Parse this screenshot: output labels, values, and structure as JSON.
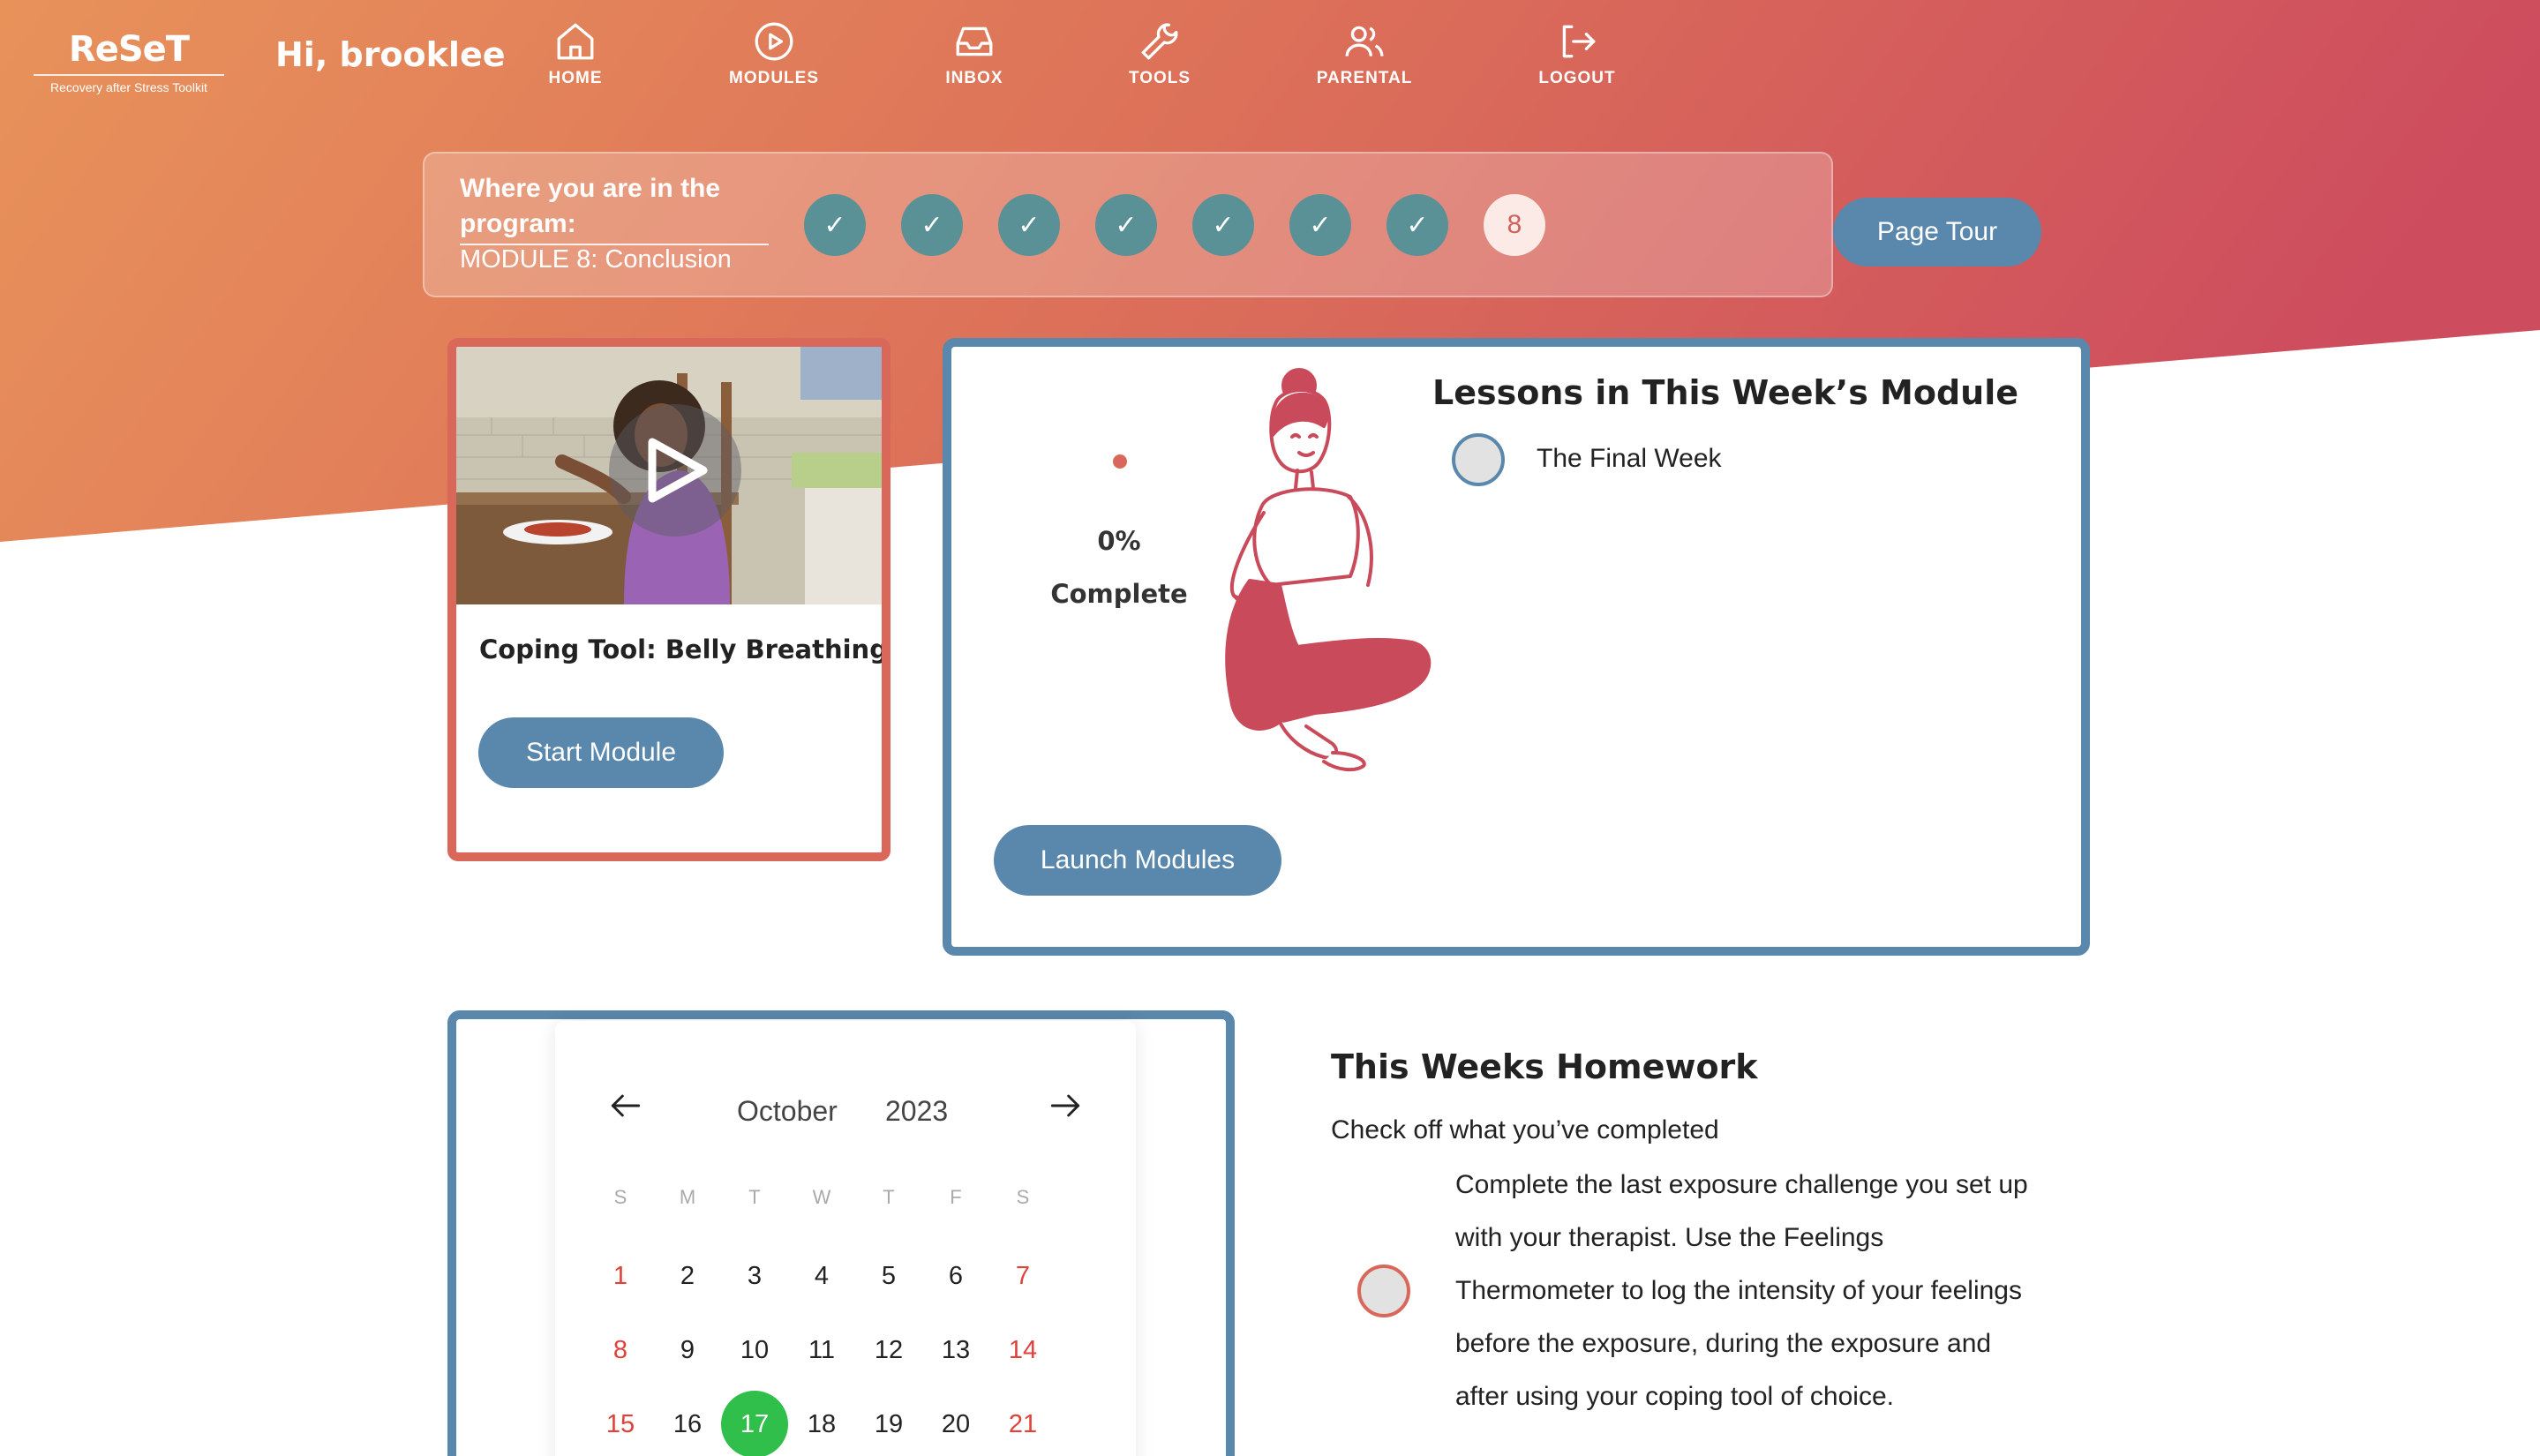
{
  "brand": {
    "logo_title": "ReSeT",
    "logo_subtitle": "Recovery after Stress Toolkit",
    "greeting": "Hi, brooklee"
  },
  "nav": {
    "items": [
      {
        "label": "HOME",
        "icon": "home-icon"
      },
      {
        "label": "MODULES",
        "icon": "play-circle-icon"
      },
      {
        "label": "INBOX",
        "icon": "inbox-icon"
      },
      {
        "label": "TOOLS",
        "icon": "wrench-icon"
      },
      {
        "label": "PARENTAL",
        "icon": "users-icon"
      },
      {
        "label": "LOGOUT",
        "icon": "logout-icon"
      }
    ]
  },
  "progress": {
    "heading": "Where you are in the program:",
    "current_module": "MODULE 8: Conclusion",
    "steps": [
      {
        "label": "✓",
        "status": "done"
      },
      {
        "label": "✓",
        "status": "done"
      },
      {
        "label": "✓",
        "status": "done"
      },
      {
        "label": "✓",
        "status": "done"
      },
      {
        "label": "✓",
        "status": "done"
      },
      {
        "label": "✓",
        "status": "done"
      },
      {
        "label": "✓",
        "status": "done"
      },
      {
        "label": "8",
        "status": "current"
      }
    ],
    "page_tour_label": "Page Tour"
  },
  "coping": {
    "title": "Coping Tool: Belly Breathing",
    "button_label": "Start Module",
    "thumbnail_icon": "play-icon"
  },
  "lessons": {
    "percent": "0%",
    "percent_label": "Complete",
    "title": "Lessons in This Week’s Module",
    "items": [
      {
        "label": "The Final Week",
        "checked": false
      }
    ],
    "launch_label": "Launch Modules"
  },
  "calendar": {
    "month": "October",
    "year": "2023",
    "weekdays": [
      "S",
      "M",
      "T",
      "W",
      "T",
      "F",
      "S"
    ],
    "weeks": [
      [
        "1",
        "2",
        "3",
        "4",
        "5",
        "6",
        "7"
      ],
      [
        "8",
        "9",
        "10",
        "11",
        "12",
        "13",
        "14"
      ],
      [
        "15",
        "16",
        "17",
        "18",
        "19",
        "20",
        "21"
      ]
    ],
    "today": "17"
  },
  "homework": {
    "title": "This Weeks Homework",
    "subtitle": "Check off what you’ve completed",
    "item_lines": [
      "Complete the last exposure challenge you set up",
      "with your therapist. Use the Feelings",
      "Thermometer to log the intensity of your feelings",
      "before the exposure, during the exposure and",
      "after using your coping tool of choice."
    ],
    "checked": false
  },
  "colors": {
    "header_gradient_start": "#e8905a",
    "header_gradient_end": "#cd5060",
    "card_red": "#d9675a",
    "card_blue": "#5a87ac",
    "step_done": "#5a9196",
    "today_green": "#2fbf4a",
    "weekend_red": "#e0413a"
  }
}
